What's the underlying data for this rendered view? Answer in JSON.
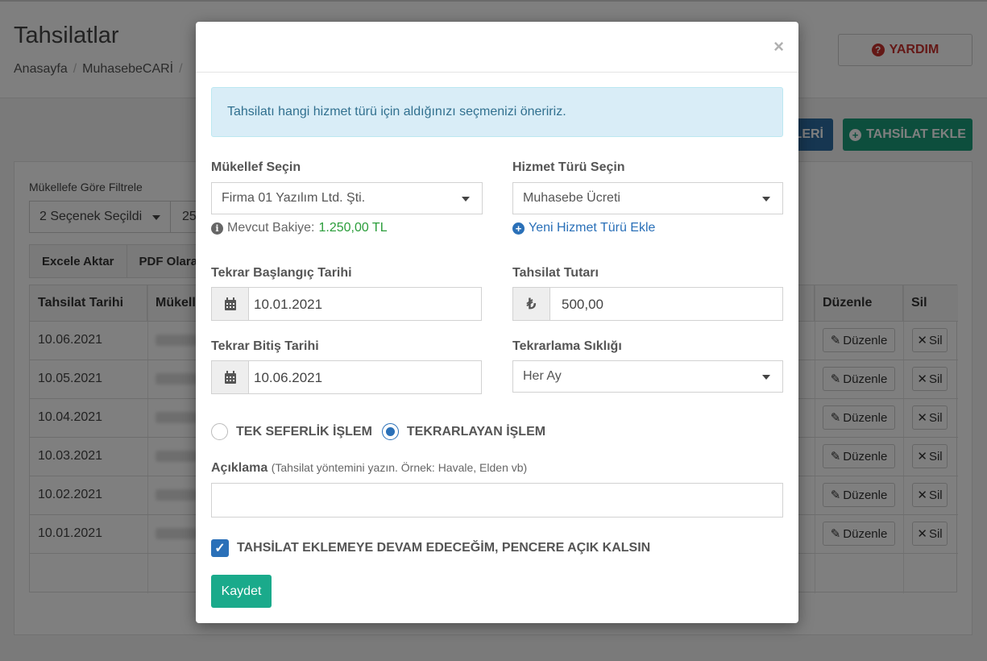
{
  "page": {
    "title": "Tahsilatlar",
    "breadcrumb": [
      "Anasayfa",
      "MuhasebeCARİ"
    ],
    "help_label": "YARDIM",
    "blue_btn_label": "LERİ",
    "add_btn_label": "TAHSİLAT EKLE",
    "filter_label": "Mükellefe Göre Filtrele",
    "filter_value": "2 Seçenek Seçildi",
    "page_size": "25",
    "toolbar": [
      "Excele Aktar",
      "PDF Olarak"
    ],
    "table_headers": [
      "Tahsilat Tarihi",
      "Mükell",
      "Düzenle",
      "Sil"
    ],
    "rows": [
      "10.06.2021",
      "10.05.2021",
      "10.04.2021",
      "10.03.2021",
      "10.02.2021",
      "10.01.2021"
    ],
    "edit_label": "Düzenle",
    "delete_label": "Sil"
  },
  "modal": {
    "close": "×",
    "alert": "Tahsilatı hangi hizmet türü için aldığınızı seçmenizi öneririz.",
    "taxpayer_label": "Mükellef Seçin",
    "taxpayer_value": "Firma 01 Yazılım Ltd. Şti.",
    "balance_label": "Mevcut Bakiye:",
    "balance_value": "1.250,00 TL",
    "service_label": "Hizmet Türü Seçin",
    "service_value": "Muhasebe Ücreti",
    "add_service_link": "Yeni Hizmet Türü Ekle",
    "start_label": "Tekrar Başlangıç Tarihi",
    "start_value": "10.01.2021",
    "amount_label": "Tahsilat Tutarı",
    "amount_value": "500,00",
    "currency_symbol": "₺",
    "end_label": "Tekrar Bitiş Tarihi",
    "end_value": "10.06.2021",
    "frequency_label": "Tekrarlama Sıklığı",
    "frequency_value": "Her Ay",
    "radio_single": "TEK SEFERLİK İŞLEM",
    "radio_recurring": "TEKRARLAYAN İŞLEM",
    "desc_label": "Açıklama",
    "desc_hint": "(Tahsilat yöntemini yazın. Örnek: Havale, Elden vb)",
    "keep_open_label": "TAHSİLAT EKLEMEYE DEVAM EDECEĞİM, PENCERE AÇIK KALSIN",
    "save_label": "Kaydet"
  },
  "colors": {
    "accent": "#2a70b8",
    "success": "#1aaa8b",
    "balance": "#2a9d3a",
    "alert_bg": "#d9edf7"
  },
  "icons": [
    "question-icon",
    "plus-circle-icon",
    "info-icon",
    "calendar-icon",
    "lira-icon",
    "edit-icon",
    "times-icon",
    "check-icon",
    "close-icon",
    "chevron-down-icon"
  ]
}
